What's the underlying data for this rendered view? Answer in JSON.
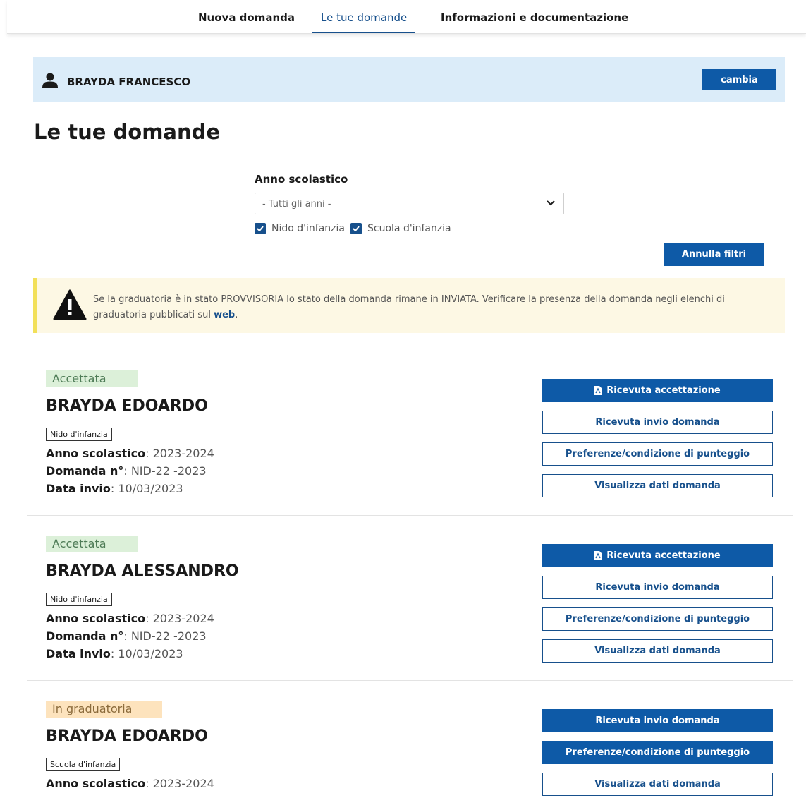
{
  "nav": {
    "tabs": [
      {
        "label": "Nuova domanda"
      },
      {
        "label": "Le tue domande"
      },
      {
        "label": "Informazioni e documentazione"
      }
    ]
  },
  "user": {
    "name": "BRAYDA FRANCESCO",
    "change_label": "cambia"
  },
  "page": {
    "title": "Le tue domande"
  },
  "filters": {
    "label": "Anno scolastico",
    "select_value": "- Tutti gli anni -",
    "checkboxes": [
      {
        "label": "Nido d'infanzia",
        "checked": true
      },
      {
        "label": "Scuola d'infanzia",
        "checked": true
      }
    ],
    "reset_label": "Annulla filtri"
  },
  "alert": {
    "text": "Se la graduatoria è in stato PROVVISORIA lo stato della domanda rimane in INVIATA. Verificare la presenza della domanda negli elenchi di graduatoria pubblicati sul ",
    "link": "web",
    "end": "."
  },
  "labels": {
    "anno": "Anno scolastico",
    "domanda": "Domanda n°",
    "data": "Data invio"
  },
  "applications": [
    {
      "status": "Accettata",
      "child": "BRAYDA EDOARDO",
      "type": "Nido d'infanzia",
      "anno": "2023-2024",
      "domanda": "NID-22      -2023",
      "data": "10/03/2023",
      "buttons": [
        "Ricevuta accettazione",
        "Ricevuta invio domanda",
        "Preferenze/condizione di punteggio",
        "Visualizza dati domanda"
      ]
    },
    {
      "status": "Accettata",
      "child": "BRAYDA ALESSANDRO",
      "type": "Nido d'infanzia",
      "anno": "2023-2024",
      "domanda": "NID-22      -2023",
      "data": "10/03/2023",
      "buttons": [
        "Ricevuta accettazione",
        "Ricevuta invio domanda",
        "Preferenze/condizione di punteggio",
        "Visualizza dati domanda"
      ]
    },
    {
      "status": "In graduatoria",
      "child": "BRAYDA EDOARDO",
      "type": "Scuola d'infanzia",
      "anno": "2023-2024",
      "buttons": [
        "Ricevuta invio domanda",
        "Preferenze/condizione di punteggio",
        "Visualizza dati domanda"
      ]
    }
  ],
  "colors": {
    "primary": "#0e5aa7",
    "accepted_bg": "#dcf0d9",
    "ranking_bg": "#fde3bd",
    "alert_bg": "#fdf8e4",
    "user_bar_bg": "#dbecf9"
  }
}
